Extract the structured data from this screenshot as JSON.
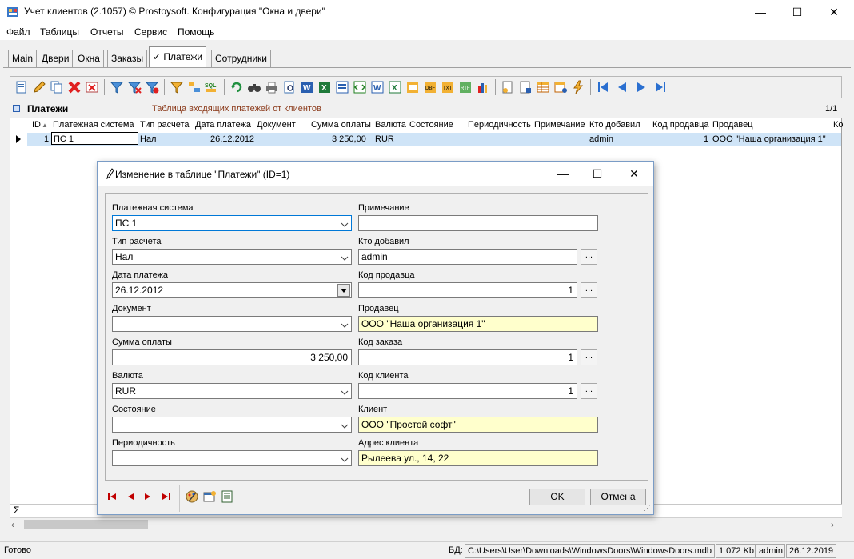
{
  "window": {
    "title": "Учет клиентов (2.1057) © Prostoysoft. Конфигурация \"Окна и двери\"",
    "minimize": "—",
    "maximize": "☐",
    "close": "✕"
  },
  "menu": [
    "Файл",
    "Таблицы",
    "Отчеты",
    "Сервис",
    "Помощь"
  ],
  "tabs": [
    {
      "label": "Main"
    },
    {
      "label": "Двери"
    },
    {
      "label": "Окна"
    },
    {
      "label": "Заказы"
    },
    {
      "label": "✓ Платежи",
      "active": true
    },
    {
      "label": "Сотрудники"
    }
  ],
  "grid": {
    "title": "Платежи",
    "description": "Таблица входящих платежей от клиентов",
    "count": "1/1",
    "columns": [
      "ID",
      "Платежная система",
      "Тип расчета",
      "Дата платежа",
      "Документ",
      "Сумма оплаты",
      "Валюта",
      "Состояние",
      "Периодичность",
      "Примечание",
      "Кто добавил",
      "Код продавца",
      "Продавец",
      "Ко"
    ],
    "row": {
      "id": "1",
      "payment_system": "ПС 1",
      "payment_type": "Нал",
      "date": "26.12.2012",
      "document": "",
      "amount": "3 250,00",
      "currency": "RUR",
      "state": "",
      "periodicity": "",
      "note": "",
      "added_by": "admin",
      "seller_code": "1",
      "seller": "ООО \"Наша организация 1\""
    },
    "sum_symbol": "Σ"
  },
  "dialog": {
    "title": "Изменение в таблице \"Платежи\" (ID=1)",
    "fields": {
      "payment_system": {
        "label": "Платежная система",
        "value": "ПС 1"
      },
      "payment_type": {
        "label": "Тип расчета",
        "value": "Нал"
      },
      "date": {
        "label": "Дата платежа",
        "value": "26.12.2012"
      },
      "document": {
        "label": "Документ",
        "value": ""
      },
      "amount": {
        "label": "Сумма оплаты",
        "value": "3 250,00"
      },
      "currency": {
        "label": "Валюта",
        "value": "RUR"
      },
      "state": {
        "label": "Состояние",
        "value": ""
      },
      "periodicity": {
        "label": "Периодичность",
        "value": ""
      },
      "note": {
        "label": "Примечание",
        "value": ""
      },
      "added_by": {
        "label": "Кто добавил",
        "value": "admin"
      },
      "seller_code": {
        "label": "Код продавца",
        "value": "1"
      },
      "seller": {
        "label": "Продавец",
        "value": "ООО \"Наша организация 1\""
      },
      "order_code": {
        "label": "Код заказа",
        "value": "1"
      },
      "client_code": {
        "label": "Код клиента",
        "value": "1"
      },
      "client": {
        "label": "Клиент",
        "value": "ООО \"Простой софт\""
      },
      "client_address": {
        "label": "Адрес клиента",
        "value": "Рылеева ул., 14, 22"
      }
    },
    "ellipsis": "...",
    "ok": "OK",
    "cancel": "Отмена"
  },
  "statusbar": {
    "status": "Готово",
    "db_label": "БД:",
    "db_path": "C:\\Users\\User\\Downloads\\WindowsDoors\\WindowsDoors.mdb",
    "db_size": "1 072 Kb",
    "user": "admin",
    "date": "26.12.2019"
  },
  "colors": {
    "selection": "#cfe4f7",
    "readonly_field": "#ffffcc",
    "description_text": "#8b3a1a",
    "focus_border": "#0078d7"
  }
}
